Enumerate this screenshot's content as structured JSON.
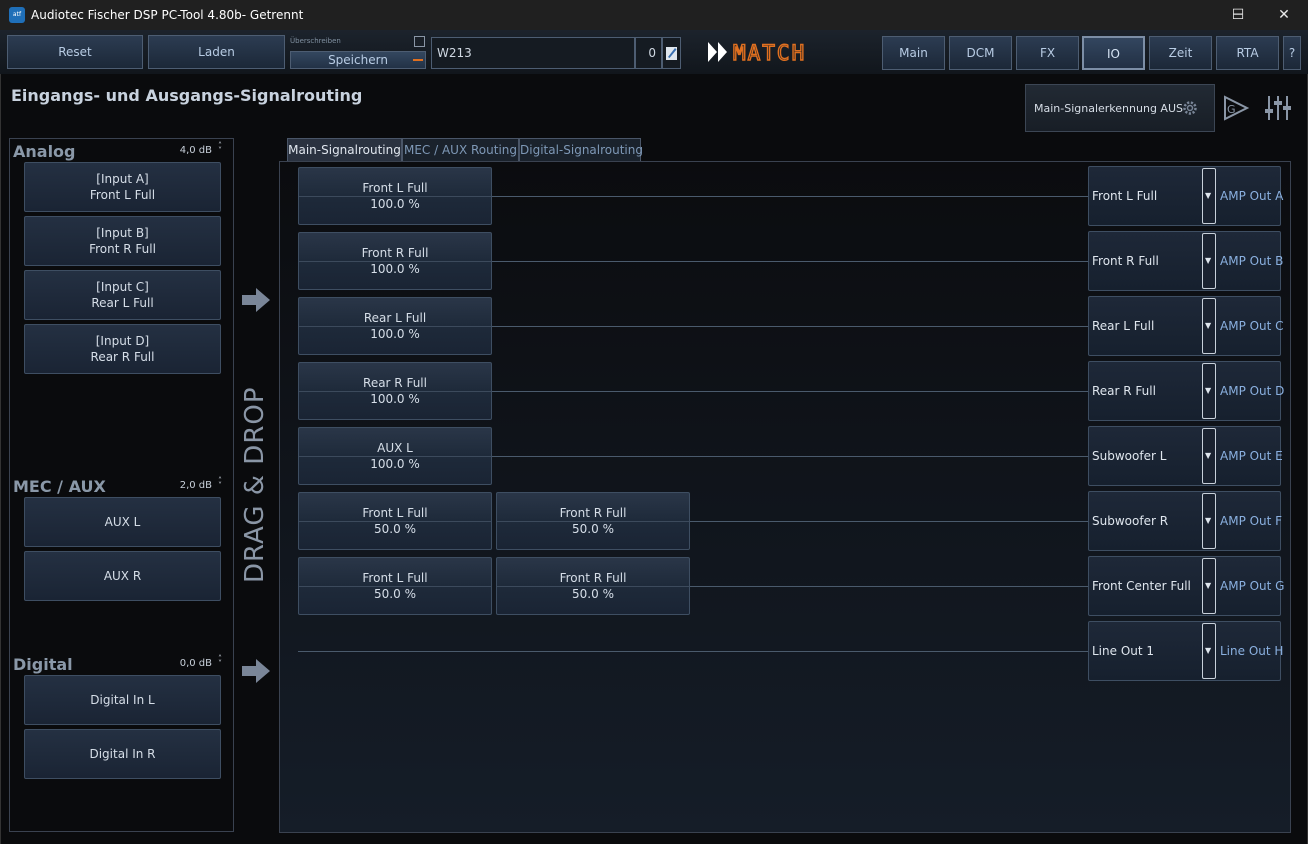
{
  "window": {
    "title": "Audiotec Fischer DSP PC-Tool 4.80b- Getrennt",
    "controls": [
      "─",
      "☐",
      "✕"
    ]
  },
  "toolbar": {
    "reset_label": "Reset",
    "load_label": "Laden",
    "overwrite_label": "Überschreiben",
    "save_label": "Speichern",
    "preset_name": "W213",
    "preset_number": "0",
    "brand": "MATCH",
    "nav": [
      "Main",
      "DCM",
      "FX",
      "IO",
      "Zeit",
      "RTA",
      "?"
    ],
    "active_nav": "IO"
  },
  "page": {
    "title": "Eingangs- und Ausgangs-Signalrouting",
    "signal_detection_label": "Main-Signalerkennung AUS",
    "drag_drop_label": "DRAG & DROP"
  },
  "inputs": {
    "analog": {
      "title": "Analog",
      "gain": "4,0 dB",
      "items": [
        {
          "line1": "[Input A]",
          "line2": "Front L Full"
        },
        {
          "line1": "[Input B]",
          "line2": "Front R Full"
        },
        {
          "line1": "[Input C]",
          "line2": "Rear L Full"
        },
        {
          "line1": "[Input D]",
          "line2": "Rear R Full"
        }
      ]
    },
    "mec_aux": {
      "title": "MEC / AUX",
      "gain": "2,0 dB",
      "items": [
        {
          "line1": "AUX L"
        },
        {
          "line1": "AUX R"
        }
      ]
    },
    "digital": {
      "title": "Digital",
      "gain": "0,0 dB",
      "items": [
        {
          "line1": "Digital In L"
        },
        {
          "line1": "Digital In R"
        }
      ]
    }
  },
  "tabs": [
    "Main-Signalrouting",
    "MEC / AUX Routing",
    "Digital-Signalrouting"
  ],
  "active_tab": "Main-Signalrouting",
  "routing": [
    {
      "sources": [
        {
          "name": "Front L Full",
          "level": "100.0 %"
        }
      ],
      "output": "Front L Full",
      "channel": "AMP Out A"
    },
    {
      "sources": [
        {
          "name": "Front R Full",
          "level": "100.0 %"
        }
      ],
      "output": "Front R Full",
      "channel": "AMP Out B"
    },
    {
      "sources": [
        {
          "name": "Rear L Full",
          "level": "100.0 %"
        }
      ],
      "output": "Rear L Full",
      "channel": "AMP Out C"
    },
    {
      "sources": [
        {
          "name": "Rear R Full",
          "level": "100.0 %"
        }
      ],
      "output": "Rear R Full",
      "channel": "AMP Out D"
    },
    {
      "sources": [
        {
          "name": "AUX L",
          "level": "100.0 %"
        }
      ],
      "output": "Subwoofer L",
      "channel": "AMP Out E"
    },
    {
      "sources": [
        {
          "name": "Front L Full",
          "level": "50.0 %"
        },
        {
          "name": "Front R Full",
          "level": "50.0 %"
        }
      ],
      "output": "Subwoofer R",
      "channel": "AMP Out F"
    },
    {
      "sources": [
        {
          "name": "Front L Full",
          "level": "50.0 %"
        },
        {
          "name": "Front R Full",
          "level": "50.0 %"
        }
      ],
      "output": "Front Center Full",
      "channel": "AMP Out G"
    },
    {
      "sources": [],
      "output": "Line Out 1",
      "channel": "Line Out H"
    }
  ],
  "colors": {
    "accent_orange": "#e07020",
    "channel_blue": "#8ab0e0",
    "button_text": "#b8cce4"
  }
}
